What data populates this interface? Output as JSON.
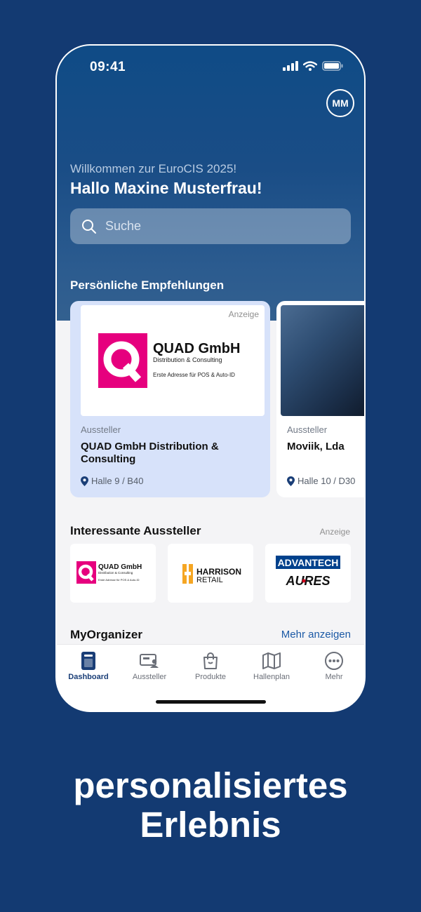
{
  "status_bar": {
    "time": "09:41"
  },
  "header": {
    "avatar_initials": "MM",
    "welcome": "Willkommen zur EuroCIS 2025!",
    "greeting": "Hallo Maxine Musterfrau!"
  },
  "search": {
    "placeholder": "Suche"
  },
  "recommendations": {
    "title": "Persönliche Empfehlungen",
    "cards": [
      {
        "ad_label": "Anzeige",
        "logo_name": "QUAD GmbH",
        "logo_line1": "Distribution & Consulting",
        "logo_line2": "Erste Adresse für POS & Auto-ID",
        "type": "Aussteller",
        "name": "QUAD GmbH Distribution & Consulting",
        "location": "Halle 9 / B40"
      },
      {
        "type": "Aussteller",
        "name": "Moviik, Lda",
        "location": "Halle 10 / D30"
      }
    ]
  },
  "interesting": {
    "title": "Interessante Aussteller",
    "ad_label": "Anzeige",
    "tiles": [
      {
        "name": "QUAD GmbH",
        "line1": "Distribution & Consulting",
        "line2": "Erste Adresse für POS & Auto-ID"
      },
      {
        "name": "HARRISON",
        "line1": "RETAIL"
      },
      {
        "name": "ADVANTECH",
        "line1": "AURES"
      }
    ]
  },
  "organizer": {
    "title": "MyOrganizer",
    "more": "Mehr anzeigen"
  },
  "tabbar": {
    "tabs": [
      {
        "label": "Dashboard",
        "icon": "dashboard-icon",
        "active": true
      },
      {
        "label": "Aussteller",
        "icon": "exhibitor-icon"
      },
      {
        "label": "Produkte",
        "icon": "shopping-bag-icon"
      },
      {
        "label": "Hallenplan",
        "icon": "map-icon"
      },
      {
        "label": "Mehr",
        "icon": "more-icon"
      }
    ]
  },
  "headline": {
    "line1": "personalisiertes",
    "line2": "Erlebnis"
  },
  "colors": {
    "background": "#133a72",
    "accent": "#1a3e77",
    "quad_magenta": "#e6007e"
  }
}
